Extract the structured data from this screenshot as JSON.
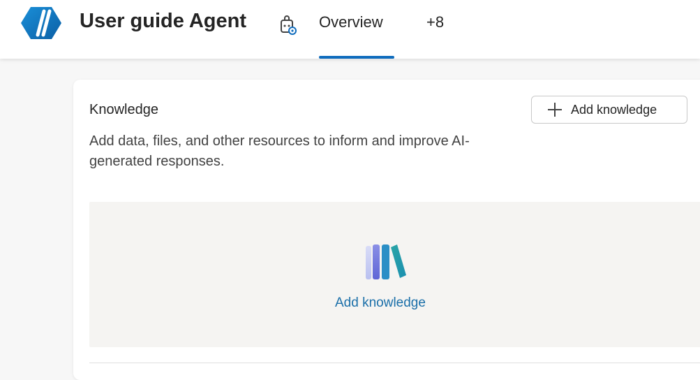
{
  "header": {
    "app_title": "User guide Agent",
    "tabs": [
      {
        "label": "Overview",
        "selected": true
      },
      {
        "label": "+8",
        "selected": false
      }
    ],
    "accent_color": "#0f6cbd"
  },
  "knowledge": {
    "title": "Knowledge",
    "description": "Add data, files, and other resources to inform and improve AI-generated responses.",
    "add_button_label": "Add knowledge",
    "empty_state_link": "Add knowledge"
  }
}
